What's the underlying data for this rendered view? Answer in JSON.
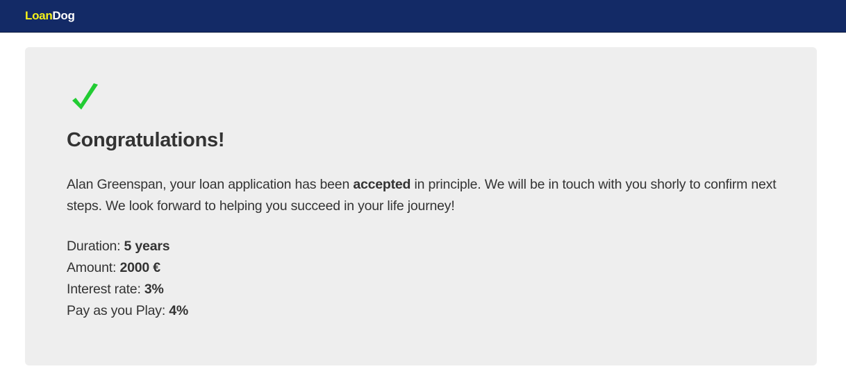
{
  "navbar": {
    "brand_part1": "Loan",
    "brand_part2": "Dog",
    "brand_color_1": "#f5f21a",
    "brand_color_2": "#ffffff",
    "background": "#132a66"
  },
  "result": {
    "icon": "checkmark-icon",
    "icon_color": "#22cc33",
    "heading": "Congratulations!",
    "message": {
      "before": "Alan Greenspan, your loan application has been ",
      "emphasis": "accepted",
      "after": " in principle. We will be in touch with you shorly to confirm next steps. We look forward to helping you succeed in your life journey!"
    },
    "details": [
      {
        "label": "Duration: ",
        "value": "5 years"
      },
      {
        "label": "Amount: ",
        "value": "2000 €"
      },
      {
        "label": "Interest rate: ",
        "value": "3%"
      },
      {
        "label": "Pay as you Play: ",
        "value": "4%"
      }
    ]
  }
}
